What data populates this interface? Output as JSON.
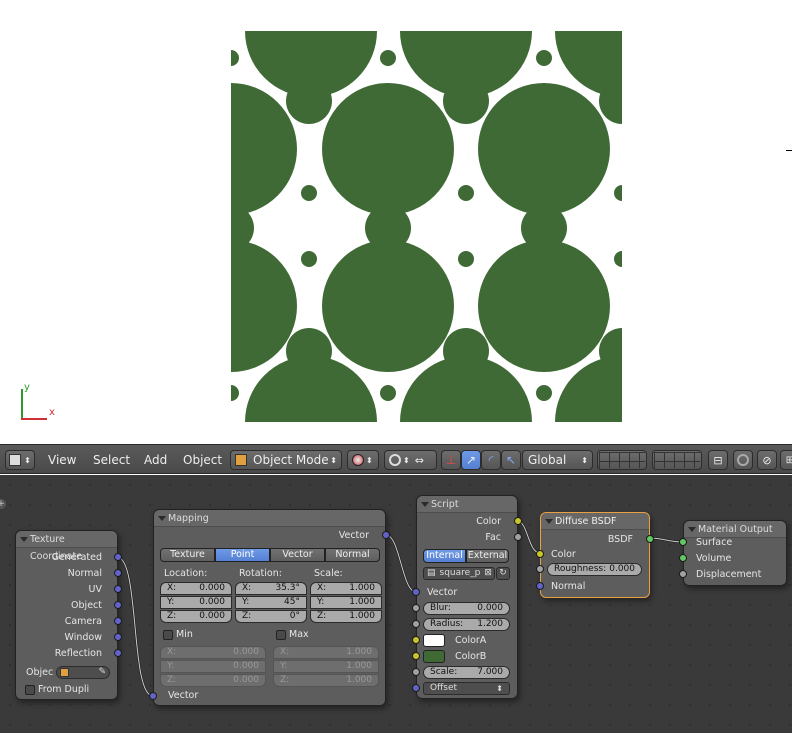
{
  "viewport": {
    "axis_y_label": "y",
    "axis_x_label": "x",
    "pattern_color": "#3f6a36"
  },
  "header": {
    "menus": [
      "View",
      "Select",
      "Add",
      "Object"
    ],
    "mode": "Object Mode",
    "orientation": "Global"
  },
  "nodes": {
    "texcoord": {
      "title": "Texture Coordinate",
      "outputs": [
        "Generated",
        "Normal",
        "UV",
        "Object",
        "Camera",
        "Window",
        "Reflection"
      ],
      "object_label": "Objec",
      "from_dupli": "From Dupli"
    },
    "mapping": {
      "title": "Mapping",
      "output": "Vector",
      "tabs": [
        "Texture",
        "Point",
        "Vector",
        "Normal"
      ],
      "active_tab": "Point",
      "location_label": "Location:",
      "rotation_label": "Rotation:",
      "scale_label": "Scale:",
      "location": [
        {
          "k": "X:",
          "v": "0.000"
        },
        {
          "k": "Y:",
          "v": "0.000"
        },
        {
          "k": "Z:",
          "v": "0.000"
        }
      ],
      "rotation": [
        {
          "k": "X:",
          "v": "35.3°"
        },
        {
          "k": "Y:",
          "v": "45°"
        },
        {
          "k": "Z:",
          "v": "0°"
        }
      ],
      "scale": [
        {
          "k": "X:",
          "v": "1.000"
        },
        {
          "k": "Y:",
          "v": "1.000"
        },
        {
          "k": "Z:",
          "v": "1.000"
        }
      ],
      "min_label": "Min",
      "max_label": "Max",
      "min": [
        {
          "k": "X:",
          "v": "0.000"
        },
        {
          "k": "Y:",
          "v": "0.000"
        },
        {
          "k": "Z:",
          "v": "0.000"
        }
      ],
      "max": [
        {
          "k": "X:",
          "v": "1.000"
        },
        {
          "k": "Y:",
          "v": "1.000"
        },
        {
          "k": "Z:",
          "v": "1.000"
        }
      ],
      "input": "Vector"
    },
    "script": {
      "title": "Script",
      "outputs": [
        "Color",
        "Fac"
      ],
      "mode_internal": "Internal",
      "mode_external": "External",
      "script_name": "square_p",
      "inputs": {
        "vector": "Vector",
        "blur_label": "Blur:",
        "blur": "0.000",
        "radius_label": "Radius:",
        "radius": "1.200",
        "colorA": "ColorA",
        "colorB": "ColorB",
        "scale_label": "Scale:",
        "scale": "7.000",
        "offset": "Offset"
      },
      "colorA_value": "#ffffff",
      "colorB_value": "#3f6a36"
    },
    "diffuse": {
      "title": "Diffuse BSDF",
      "output": "BSDF",
      "color": "Color",
      "roughness_label": "Roughness:",
      "roughness": "0.000",
      "normal": "Normal"
    },
    "output": {
      "title": "Material Output",
      "inputs": [
        "Surface",
        "Volume",
        "Displacement"
      ]
    }
  }
}
